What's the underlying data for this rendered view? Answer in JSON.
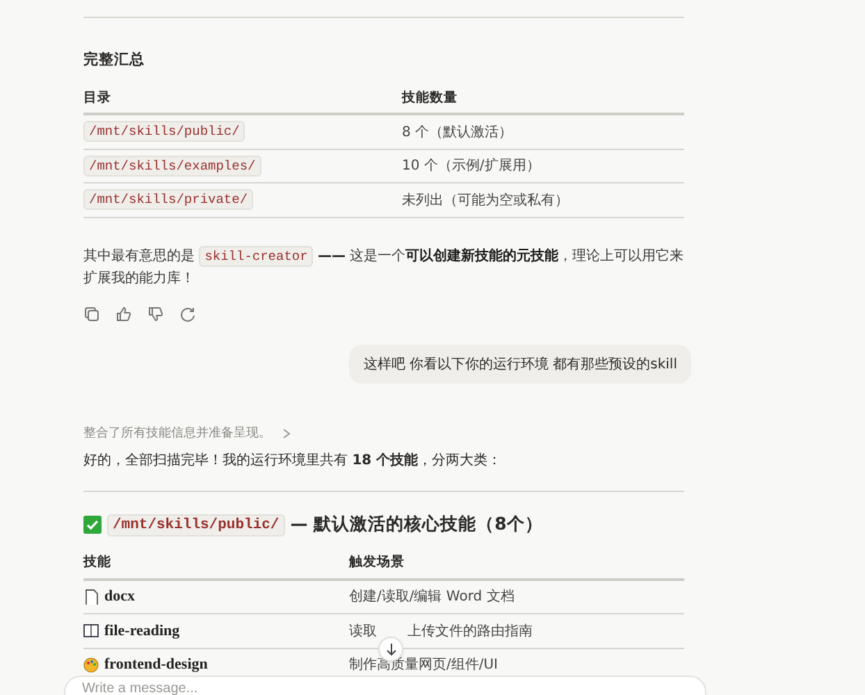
{
  "summary": {
    "title": "完整汇总",
    "columns": [
      "目录",
      "技能数量"
    ],
    "rows": [
      {
        "path": "/mnt/skills/public/",
        "count": "8 个（默认激活）"
      },
      {
        "path": "/mnt/skills/examples/",
        "count": "10 个（示例/扩展用）"
      },
      {
        "path": "/mnt/skills/private/",
        "count": "未列出（可能为空或私有）"
      }
    ]
  },
  "message": [
    {
      "kind": "text",
      "text": "其中最有意思的是 "
    },
    {
      "kind": "code",
      "text": "skill-creator"
    },
    {
      "kind": "text",
      "text": " **——** 这是一个**可以创建新技能的元技能**，理论上可以用它来扩展我的能力库！"
    }
  ],
  "user_message": "这样吧 你看以下你的运行环境 都有那些预设的skill",
  "thinking": "整合了所有技能信息并准备呈现。",
  "reply": "好的，全部扫描完毕！我的运行环境里共有 **18 个技能**，分两大类：",
  "section": {
    "path": "/mnt/skills/public/",
    "title": "— 默认激活的核心技能（8个）",
    "columns": [
      "技能",
      "触发场景"
    ],
    "rows": [
      {
        "kind": "document",
        "name": "docx",
        "scene": [
          "创建/读取/编辑 Word 文档"
        ]
      },
      {
        "kind": "book",
        "name": "file-reading",
        "scene": [
          "读取",
          "上传文件的路由指南"
        ]
      },
      {
        "kind": "palette",
        "name": "frontend-design",
        "scene": [
          "制作高质量网页/组件/UI"
        ]
      }
    ]
  },
  "composer": {
    "placeholder": "Write a message..."
  }
}
